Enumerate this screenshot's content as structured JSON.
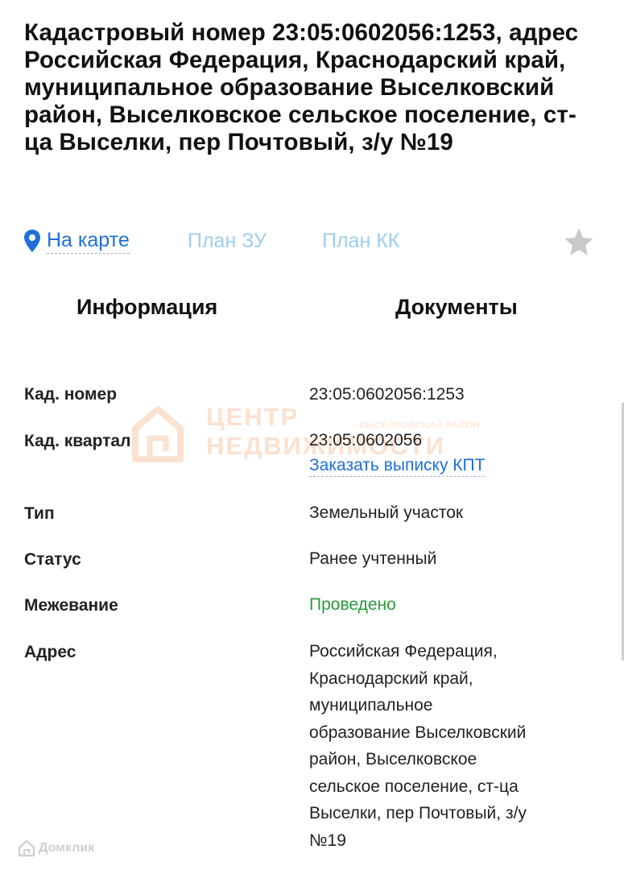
{
  "header": {
    "title": "Кадастровый номер 23:05:0602056:1253, адрес Российская Федерация, Краснодарский край, муниципальное образование Выселковский район, Выселковское сельское поселение, ст-ца Выселки, пер Почтовый, з/у №19"
  },
  "links": {
    "map_label": "На карте",
    "plan_zu_label": "План ЗУ",
    "plan_kk_label": "План КК",
    "map_icon": "map-pin-icon",
    "favorite_icon": "star-icon"
  },
  "tabs": {
    "info_label": "Информация",
    "docs_label": "Документы"
  },
  "details": {
    "cad_number": {
      "label": "Кад. номер",
      "value": "23:05:0602056:1253"
    },
    "cad_quarter": {
      "label": "Кад. квартал",
      "value": "23:05:0602056",
      "link": "Заказать выписку КПТ"
    },
    "type": {
      "label": "Тип",
      "value": "Земельный участок"
    },
    "status": {
      "label": "Статус",
      "value": "Ранее учтенный"
    },
    "survey": {
      "label": "Межевание",
      "value": "Проведено"
    },
    "address": {
      "label": "Адрес",
      "lines": [
        "Российская Федерация,",
        "Краснодарский край,",
        "муниципальное",
        "образование Выселковский",
        "район, Выселковское",
        "сельское поселение, ст-ца",
        "Выселки, пер Почтовый, з/у",
        "№19"
      ]
    }
  },
  "watermark": {
    "line1": "ЦЕНТР",
    "line2": "НЕДВИЖИМОСТИ",
    "sub": "ВЫСЕЛКОВСКИЙ РАЙОН"
  },
  "footer": {
    "brand": "Домклик"
  },
  "colors": {
    "link": "#1f6fd6",
    "link_light": "#9fcdee",
    "success": "#2a9a3a",
    "star": "#c9c9c9",
    "watermark": "#f07a2a"
  }
}
